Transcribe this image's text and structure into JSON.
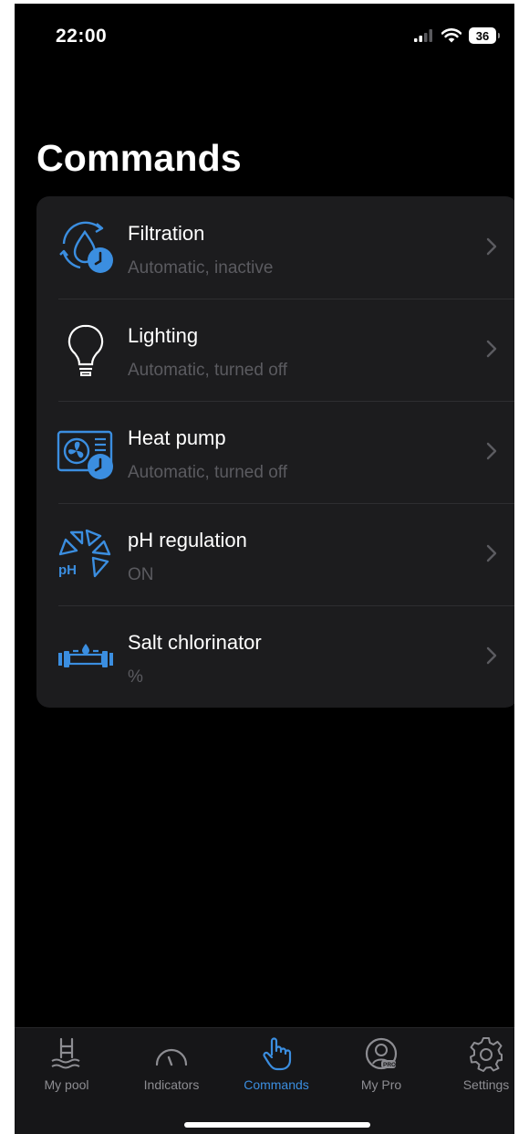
{
  "status_bar": {
    "time": "22:00",
    "battery": "36"
  },
  "page": {
    "title": "Commands"
  },
  "commands": [
    {
      "title": "Filtration",
      "status": "Automatic, inactive",
      "icon": "filtration-icon"
    },
    {
      "title": "Lighting",
      "status": "Automatic, turned off",
      "icon": "light-bulb-icon"
    },
    {
      "title": "Heat pump",
      "status": "Automatic, turned off",
      "icon": "heat-pump-icon"
    },
    {
      "title": "pH regulation",
      "status": "ON",
      "icon": "ph-regulation-icon"
    },
    {
      "title": "Salt chlorinator",
      "status": "%",
      "icon": "salt-chlorinator-icon"
    }
  ],
  "tab_bar": {
    "tabs": [
      {
        "label": "My pool",
        "icon": "pool-ladder-icon"
      },
      {
        "label": "Indicators",
        "icon": "gauge-icon"
      },
      {
        "label": "Commands",
        "icon": "pointing-hand-icon",
        "active": true
      },
      {
        "label": "My Pro",
        "icon": "pro-person-icon"
      },
      {
        "label": "Settings",
        "icon": "gear-icon"
      }
    ]
  },
  "colors": {
    "accent": "#3b8ee0",
    "background": "#000000",
    "card": "#1c1c1e",
    "secondary_text": "#5b5b60",
    "tab_inactive": "#8d8d92"
  }
}
